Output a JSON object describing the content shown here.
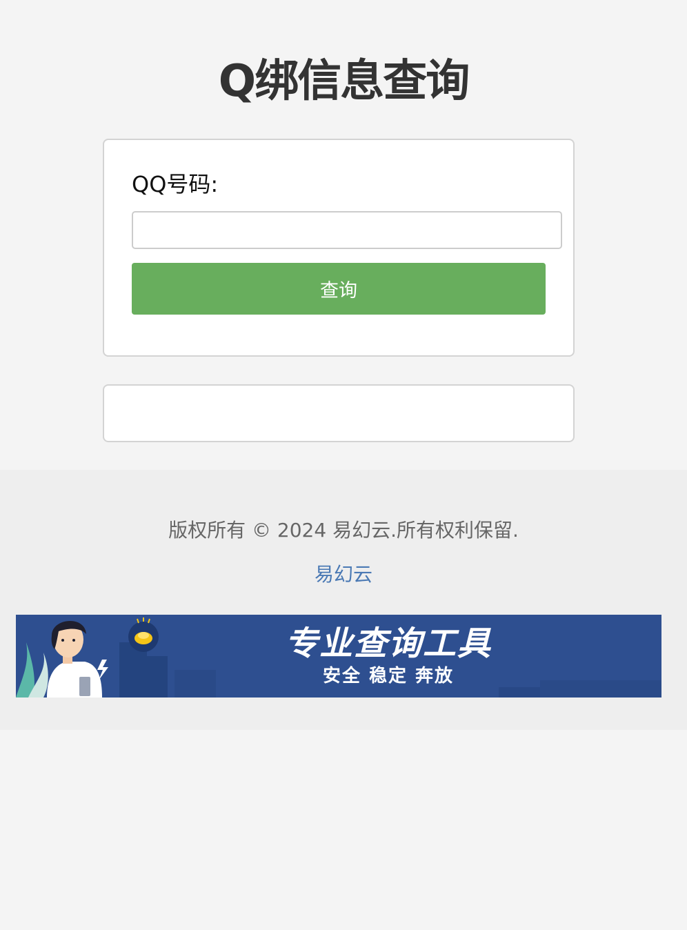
{
  "header": {
    "title": "Q绑信息查询"
  },
  "form": {
    "label": "QQ号码:",
    "input_value": "",
    "input_placeholder": "",
    "button_label": "查询"
  },
  "result": {
    "text": ""
  },
  "footer": {
    "copyright": "版权所有 © 2024 易幻云.所有权利保留.",
    "link_label": "易幻云"
  },
  "banner": {
    "title": "专业查询工具",
    "subtitle": "安全 稳定 奔放"
  },
  "colors": {
    "page_bg": "#f4f4f4",
    "footer_bg": "#eeeeee",
    "button_bg": "#68ae5d",
    "link": "#4a79b4",
    "banner_bg": "#2e4f90"
  }
}
